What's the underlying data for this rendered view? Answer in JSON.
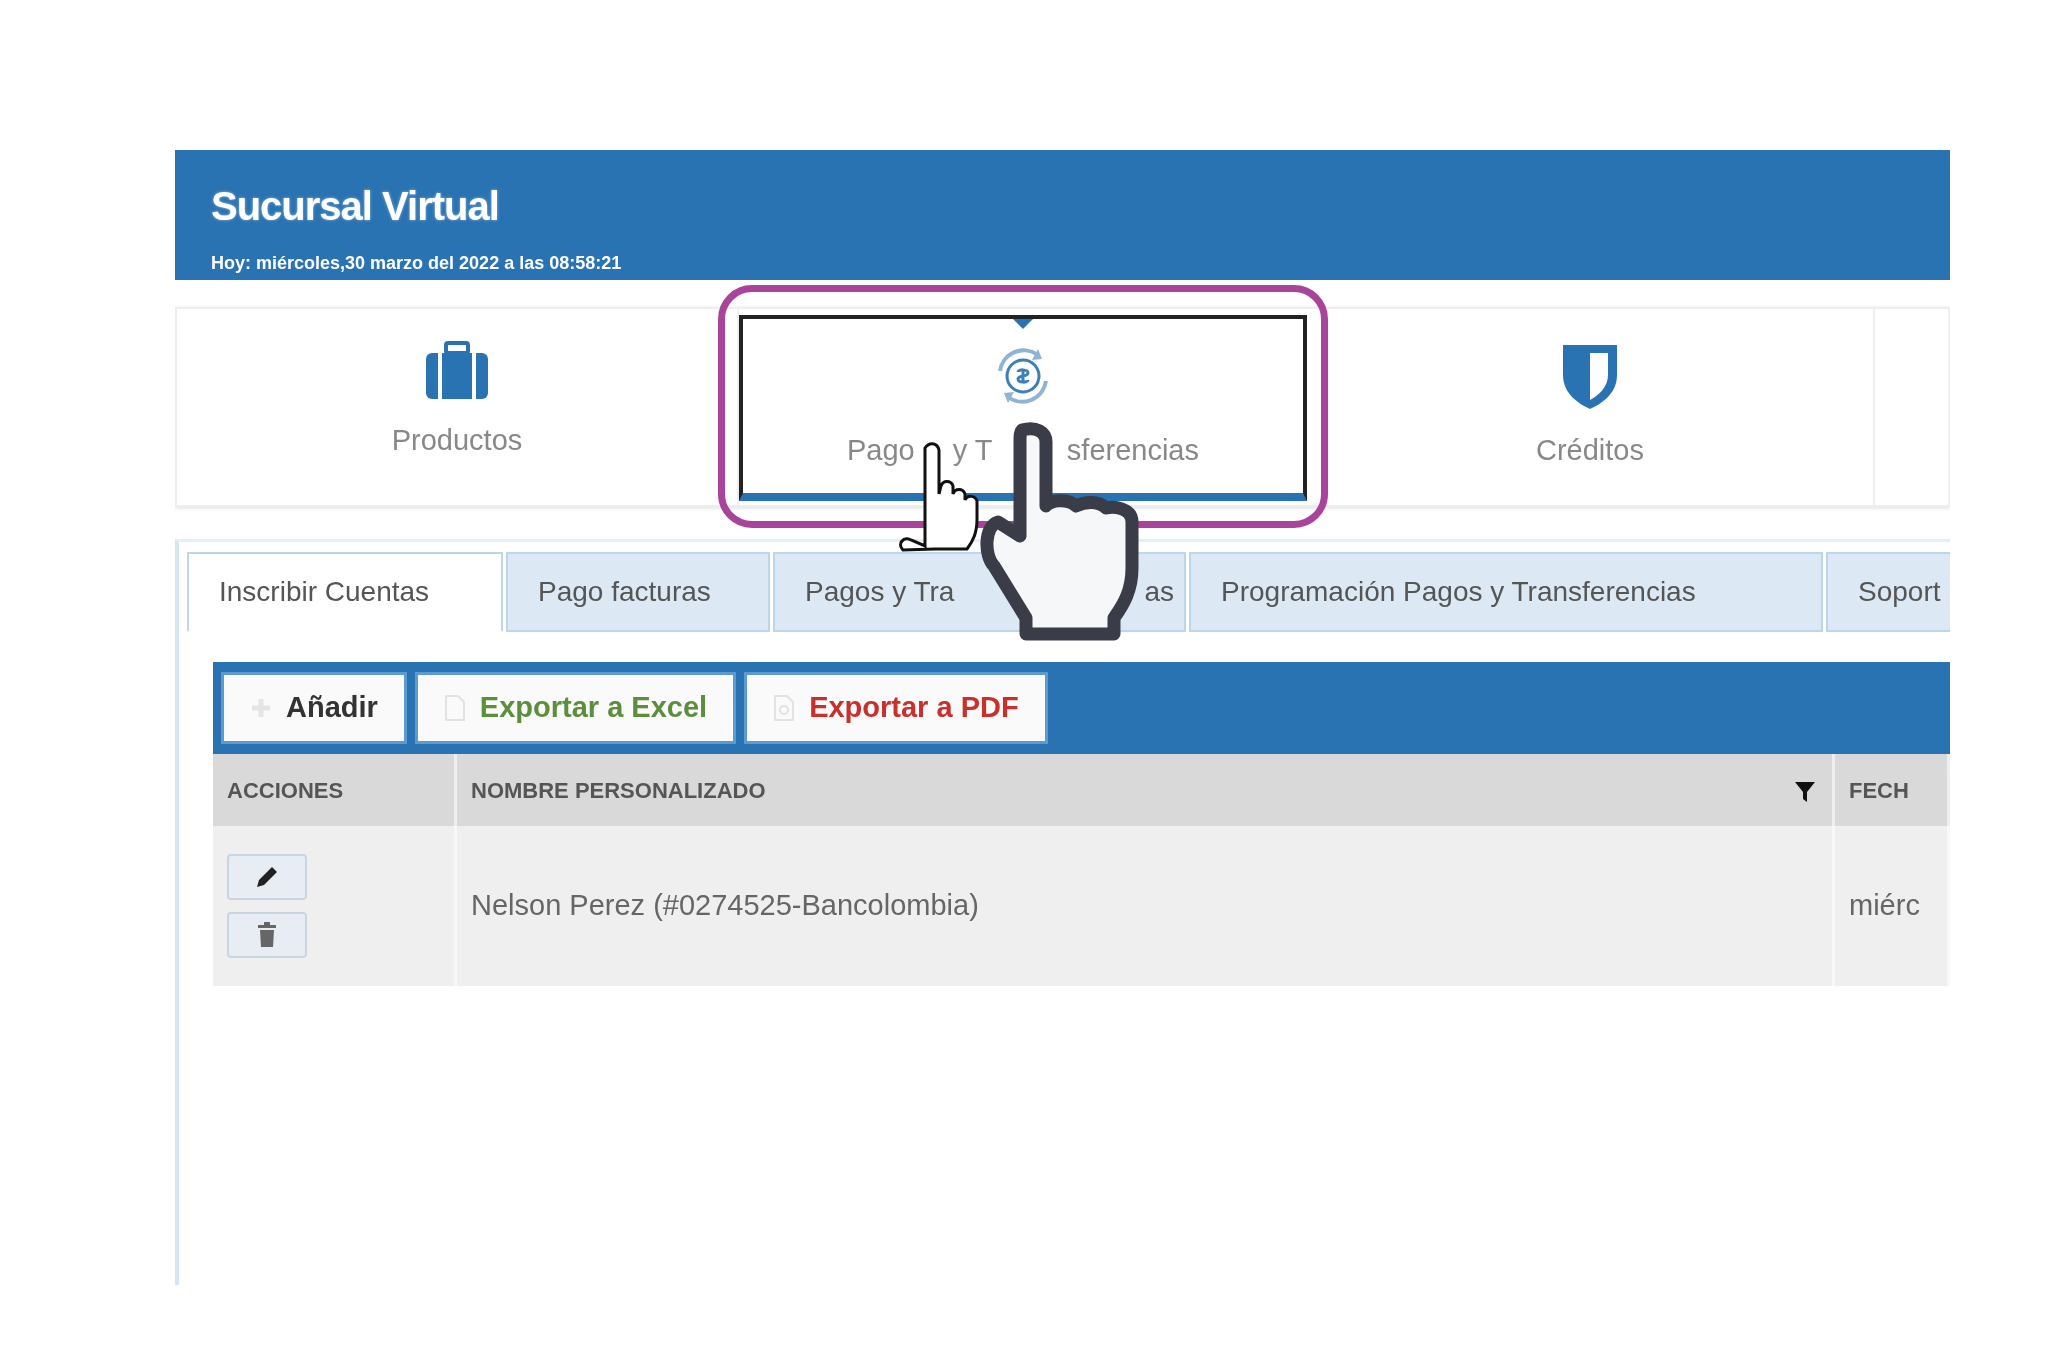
{
  "header": {
    "title": "Sucursal Virtual",
    "date": "Hoy: miércoles,30 marzo del 2022 a las 08:58:21"
  },
  "tiles": [
    {
      "label_parts": [
        "Productos"
      ],
      "selected": false
    },
    {
      "label_parts": [
        "Pago",
        "y T",
        "sferencias"
      ],
      "selected": true
    },
    {
      "label_parts": [
        "Créditos"
      ],
      "selected": false
    }
  ],
  "tabs": [
    {
      "label_parts": [
        "Inscribir Cuentas"
      ],
      "selected": true
    },
    {
      "label_parts": [
        "Pago facturas"
      ],
      "selected": false
    },
    {
      "label_parts": [
        "Pagos y Tra",
        "as"
      ],
      "selected": false
    },
    {
      "label_parts": [
        "Programación Pagos y Transferencias"
      ],
      "selected": false
    },
    {
      "label_parts": [
        "Soport"
      ],
      "selected": false
    }
  ],
  "toolbar": [
    {
      "label": "Añadir",
      "kind": "add"
    },
    {
      "label": "Exportar a Excel",
      "kind": "excel"
    },
    {
      "label": "Exportar a PDF",
      "kind": "pdf"
    }
  ],
  "table": {
    "columns": [
      {
        "label": "ACCIONES",
        "filter": false
      },
      {
        "label": "NOMBRE PERSONALIZADO",
        "filter": true
      },
      {
        "label": "FECH",
        "filter": false
      }
    ],
    "rows": [
      {
        "cells": [
          {
            "kind": "actions",
            "actions": [
              {
                "kind": "edit"
              },
              {
                "kind": "delete"
              }
            ]
          },
          {
            "kind": "text",
            "text": "Nelson Perez (#0274525-Bancolombia)"
          },
          {
            "kind": "text",
            "text": "miérc"
          }
        ]
      }
    ]
  },
  "annotation": {
    "highlight": true,
    "hand_cursor": true
  }
}
